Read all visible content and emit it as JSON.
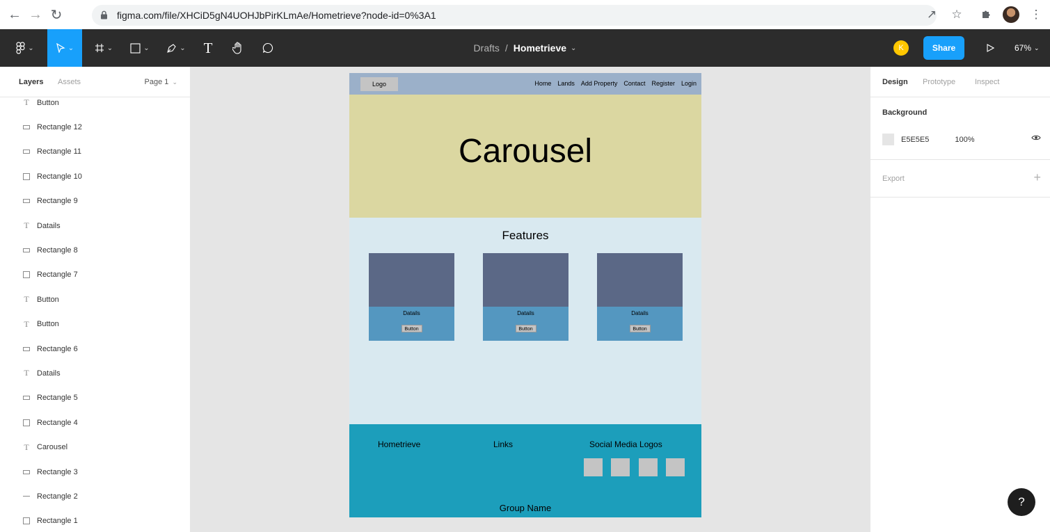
{
  "browser": {
    "url": "figma.com/file/XHCiD5gN4UOHJbPirKLmAe/Hometrieve?node-id=0%3A1",
    "back_icon": "arrow-left",
    "forward_icon": "arrow-right",
    "reload_icon": "reload",
    "share_icon": "share",
    "star_icon": "star",
    "extensions_icon": "puzzle",
    "menu_icon": "vertical-dots"
  },
  "toolbar": {
    "breadcrumb": "Drafts",
    "file_name": "Hometrieve",
    "avatar_initial": "K",
    "share_label": "Share",
    "zoom": "67%",
    "text_tool": "T"
  },
  "left_panel": {
    "tabs": [
      "Layers",
      "Assets"
    ],
    "page": "Page 1",
    "layers": [
      {
        "name": "Button",
        "icon": "text"
      },
      {
        "name": "Rectangle 12",
        "icon": "rect-wide"
      },
      {
        "name": "Rectangle 11",
        "icon": "rect-wide"
      },
      {
        "name": "Rectangle 10",
        "icon": "rect"
      },
      {
        "name": "Rectangle 9",
        "icon": "rect-wide"
      },
      {
        "name": "Datails",
        "icon": "text"
      },
      {
        "name": "Rectangle 8",
        "icon": "rect-wide"
      },
      {
        "name": "Rectangle 7",
        "icon": "rect"
      },
      {
        "name": "Button",
        "icon": "text"
      },
      {
        "name": "Button",
        "icon": "text"
      },
      {
        "name": "Rectangle 6",
        "icon": "rect-wide"
      },
      {
        "name": "Datails",
        "icon": "text"
      },
      {
        "name": "Rectangle 5",
        "icon": "rect-wide"
      },
      {
        "name": "Rectangle 4",
        "icon": "rect"
      },
      {
        "name": "Carousel",
        "icon": "text"
      },
      {
        "name": "Rectangle 3",
        "icon": "rect-wide"
      },
      {
        "name": "Rectangle 2",
        "icon": "line"
      },
      {
        "name": "Rectangle 1",
        "icon": "rect"
      }
    ]
  },
  "frame": {
    "logo": "Logo",
    "nav_links": [
      "Home",
      "Lands",
      "Add Property",
      "Contact",
      "Register",
      "Login"
    ],
    "carousel": "Carousel",
    "features_title": "Features",
    "cards": [
      {
        "title": "Datails",
        "button": "Button"
      },
      {
        "title": "Datails",
        "button": "Button"
      },
      {
        "title": "Datails",
        "button": "Button"
      }
    ],
    "footer": {
      "brand": "Hometrieve",
      "links": "Links",
      "social": "Social Media Logos",
      "group_name": "Group Name"
    }
  },
  "right_panel": {
    "tabs": [
      "Design",
      "Prototype",
      "Inspect"
    ],
    "background_title": "Background",
    "background_hex": "E5E5E5",
    "background_opacity": "100%",
    "export_label": "Export"
  },
  "help": "?",
  "colors": {
    "figma_blue": "#18a0fb",
    "toolbar_dark": "#2c2c2c",
    "canvas_bg": "#e5e5e5",
    "nav_bg": "#9bb0c9",
    "carousel_bg": "#dbd7a1",
    "content_bg": "#d9e9f0",
    "card_image": "#5b6886",
    "card_body": "#5497c0",
    "footer_bg": "#1c9ebb",
    "avatar_yellow": "#ffc700"
  }
}
